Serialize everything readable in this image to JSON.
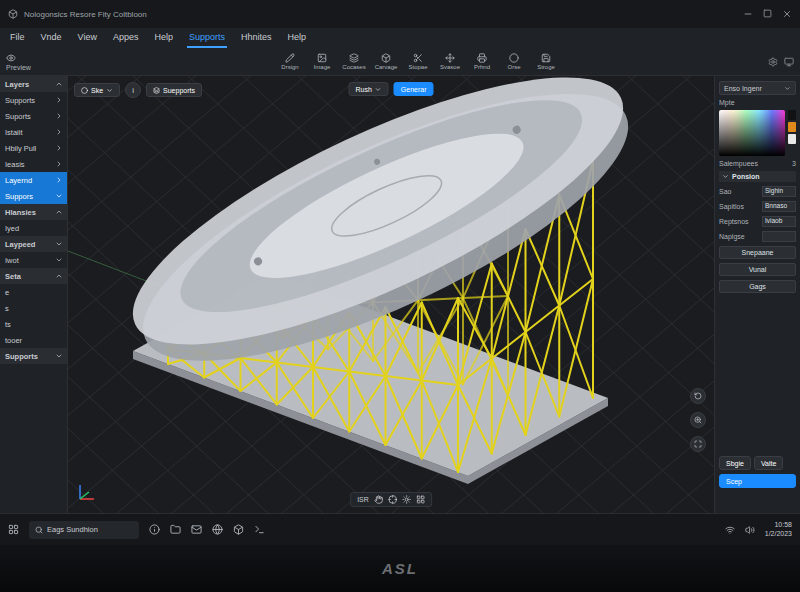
{
  "window": {
    "title": "Nologonsics Resore Fity Coltbloon"
  },
  "menu": [
    {
      "label": "File",
      "selected": false
    },
    {
      "label": "Vnde",
      "selected": false
    },
    {
      "label": "View",
      "selected": false
    },
    {
      "label": "Appes",
      "selected": false
    },
    {
      "label": "Help",
      "selected": false
    },
    {
      "label": "Supports",
      "selected": true
    },
    {
      "label": "Hhnites",
      "selected": false
    },
    {
      "label": "Help",
      "selected": false
    }
  ],
  "toolbar": {
    "preview": "Preview",
    "tools": [
      "Drsign",
      "Image",
      "Cocases",
      "Carvage",
      "Stopae",
      "Svasoe",
      "Prhnd",
      "Orse",
      "Stroge"
    ]
  },
  "left_panel": {
    "items": [
      {
        "label": "Layers",
        "kind": "header",
        "expanded": true,
        "selected": false
      },
      {
        "label": "Supports",
        "kind": "item",
        "expanded": false,
        "selected": false
      },
      {
        "label": "Suports",
        "kind": "item",
        "expanded": false,
        "selected": false
      },
      {
        "label": "Istaiit",
        "kind": "item",
        "expanded": false,
        "selected": false
      },
      {
        "label": "Hbily Pull",
        "kind": "item",
        "expanded": false,
        "selected": false
      },
      {
        "label": "Ieasis",
        "kind": "item",
        "expanded": false,
        "selected": false
      },
      {
        "label": "Layernd",
        "kind": "item",
        "expanded": false,
        "selected": true
      },
      {
        "label": "Suppors",
        "kind": "item",
        "expanded": true,
        "selected": true
      },
      {
        "label": "Hlansies",
        "kind": "header",
        "expanded": true,
        "selected": false
      },
      {
        "label": "Iyed",
        "kind": "leaf",
        "expanded": false,
        "selected": false
      },
      {
        "label": "Laypeed",
        "kind": "header",
        "expanded": false,
        "selected": false
      },
      {
        "label": "Iwot",
        "kind": "item",
        "expanded": true,
        "selected": false
      },
      {
        "label": "Seta",
        "kind": "header",
        "expanded": true,
        "selected": false
      },
      {
        "label": "e",
        "kind": "leaf",
        "expanded": false,
        "selected": false
      },
      {
        "label": "s",
        "kind": "leaf",
        "expanded": false,
        "selected": false
      },
      {
        "label": "ts",
        "kind": "leaf",
        "expanded": false,
        "selected": false
      },
      {
        "label": "tooer",
        "kind": "leaf",
        "expanded": false,
        "selected": false
      },
      {
        "label": "Supports",
        "kind": "header",
        "expanded": false,
        "selected": false
      }
    ]
  },
  "viewport": {
    "view_select": "Ske",
    "info": "i",
    "supports_button": "Suepports",
    "mode_select": "Rush",
    "generate_button": "Generar",
    "bottom_tools": [
      "ISR"
    ]
  },
  "right_panel": {
    "select": "Enso Ingenr",
    "color_label": "Mpte",
    "size_label": "Salempuees",
    "size_value": "3",
    "section": "Ponsion",
    "fields": [
      {
        "label": "Sao",
        "value": "Sighin"
      },
      {
        "label": "Sapitlos",
        "value": "Bnnaso"
      },
      {
        "label": "Reptsnos",
        "value": "Iviaob"
      },
      {
        "label": "Naplgse",
        "value": ""
      }
    ],
    "buttons": [
      "Snepaane",
      "Vunal",
      "Gags"
    ],
    "footer": {
      "chips": [
        "Sbgie",
        "Valte"
      ],
      "primary": "Scep"
    }
  },
  "taskbar": {
    "search": "Eags Sundhion",
    "time": "10:58",
    "date": "1/2/2023"
  },
  "monitor": {
    "logo": "ASL"
  }
}
